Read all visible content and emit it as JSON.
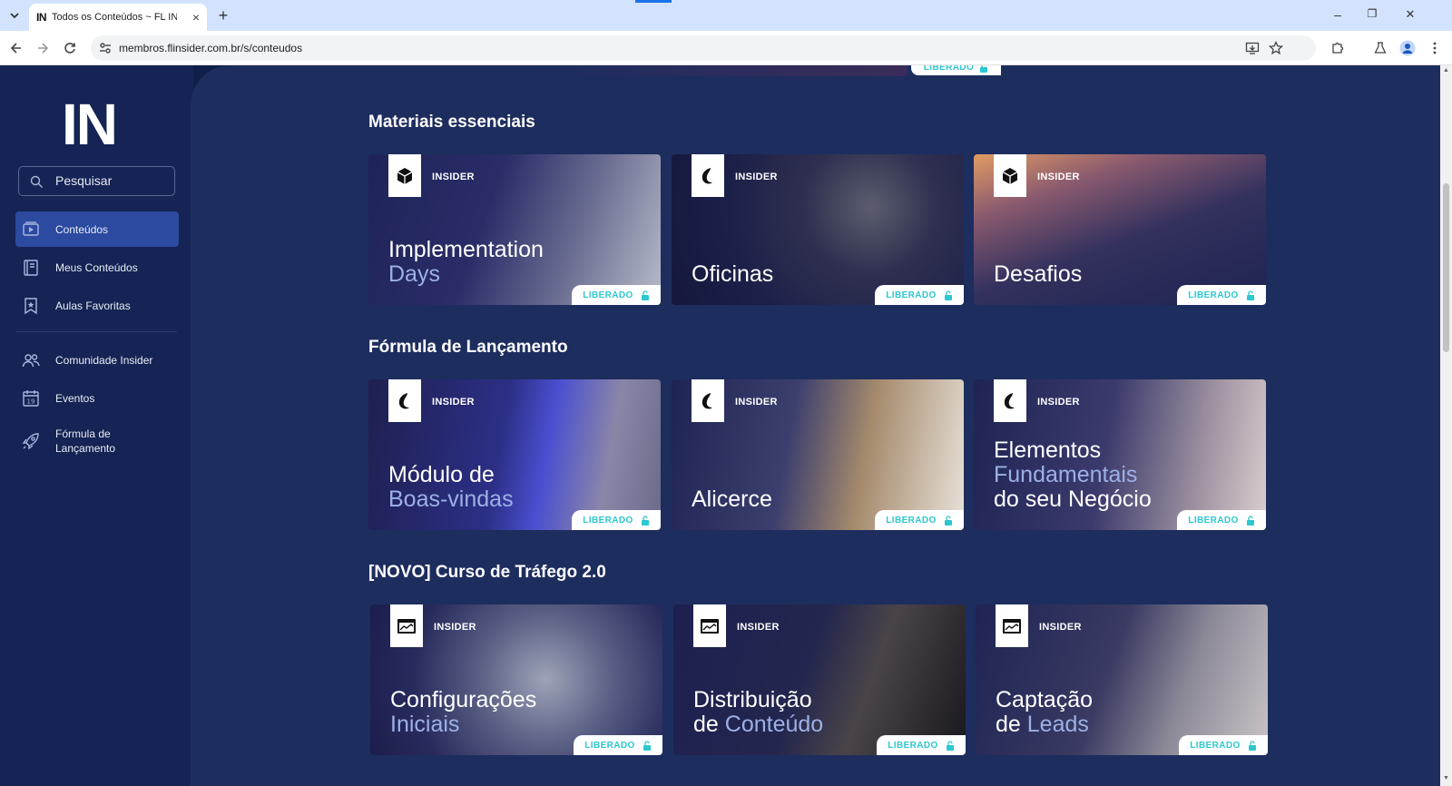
{
  "browser": {
    "tab_title": "Todos os Conteúdos ~ FL INSIDER",
    "tab_favicon": "IN",
    "url": "membros.flinsider.com.br/s/conteudos",
    "new_tab": "+",
    "close_tab": "×",
    "window_controls": [
      "–",
      "❐",
      "✕"
    ]
  },
  "sidebar": {
    "logo": "IN",
    "search_placeholder": "Pesquisar",
    "items": [
      {
        "label": "Conteúdos",
        "icon": "play-video-icon",
        "active": true
      },
      {
        "label": "Meus Conteúdos",
        "icon": "book-icon"
      },
      {
        "label": "Aulas Favoritas",
        "icon": "bookmark-star-icon"
      },
      {
        "label": "Comunidade Insider",
        "icon": "people-icon"
      },
      {
        "label": "Eventos",
        "icon": "calendar-icon"
      },
      {
        "label": "Fórmula de Lançamento",
        "icon": "rocket-icon"
      }
    ],
    "calendar_day": "19"
  },
  "main": {
    "top_pill": "LIBERADO",
    "sections": [
      {
        "title": "Materiais essenciais",
        "cards": [
          {
            "brand": "INSIDER",
            "title_1": "Implementation",
            "title_2": "Days",
            "status": "LIBERADO",
            "icon": "cube-icon"
          },
          {
            "brand": "INSIDER",
            "title_1": "Oficinas",
            "title_2": "",
            "status": "LIBERADO",
            "icon": "flame-logo-icon"
          },
          {
            "brand": "INSIDER",
            "title_1": "Desafios",
            "title_2": "",
            "status": "LIBERADO",
            "icon": "cube-icon"
          }
        ]
      },
      {
        "title": "Fórmula de Lançamento",
        "cards": [
          {
            "brand": "INSIDER",
            "title_1": "Módulo de",
            "title_2": "Boas-vindas",
            "status": "LIBERADO",
            "icon": "flame-logo-icon"
          },
          {
            "brand": "INSIDER",
            "title_1": "Alicerce",
            "title_2": "",
            "status": "LIBERADO",
            "icon": "flame-logo-icon"
          },
          {
            "brand": "INSIDER",
            "title_1": "Elementos",
            "title_2": "Fundamentais",
            "title_3": "do seu Negócio",
            "status": "LIBERADO",
            "icon": "flame-logo-icon"
          }
        ]
      },
      {
        "title": "[NOVO] Curso de Tráfego 2.0",
        "cards": [
          {
            "brand": "INSIDER",
            "title_1": "Configurações",
            "title_2": "Iniciais",
            "status": "LIBERADO",
            "icon": "browser-chart-icon"
          },
          {
            "brand": "INSIDER",
            "title_1": "Distribuição",
            "title_2a": "de ",
            "title_2b": "Conteúdo",
            "status": "LIBERADO",
            "icon": "browser-chart-icon"
          },
          {
            "brand": "INSIDER",
            "title_1": "Captação",
            "title_2a": "de ",
            "title_2b": "Leads",
            "status": "LIBERADO",
            "icon": "browser-chart-icon"
          }
        ]
      }
    ]
  },
  "colors": {
    "sidebar_bg": "#152454",
    "main_bg": "#1d2d5e",
    "active_item": "#2b4aa0",
    "pill_text": "#2cc7d0",
    "title_highlight": "#9db0e6"
  }
}
